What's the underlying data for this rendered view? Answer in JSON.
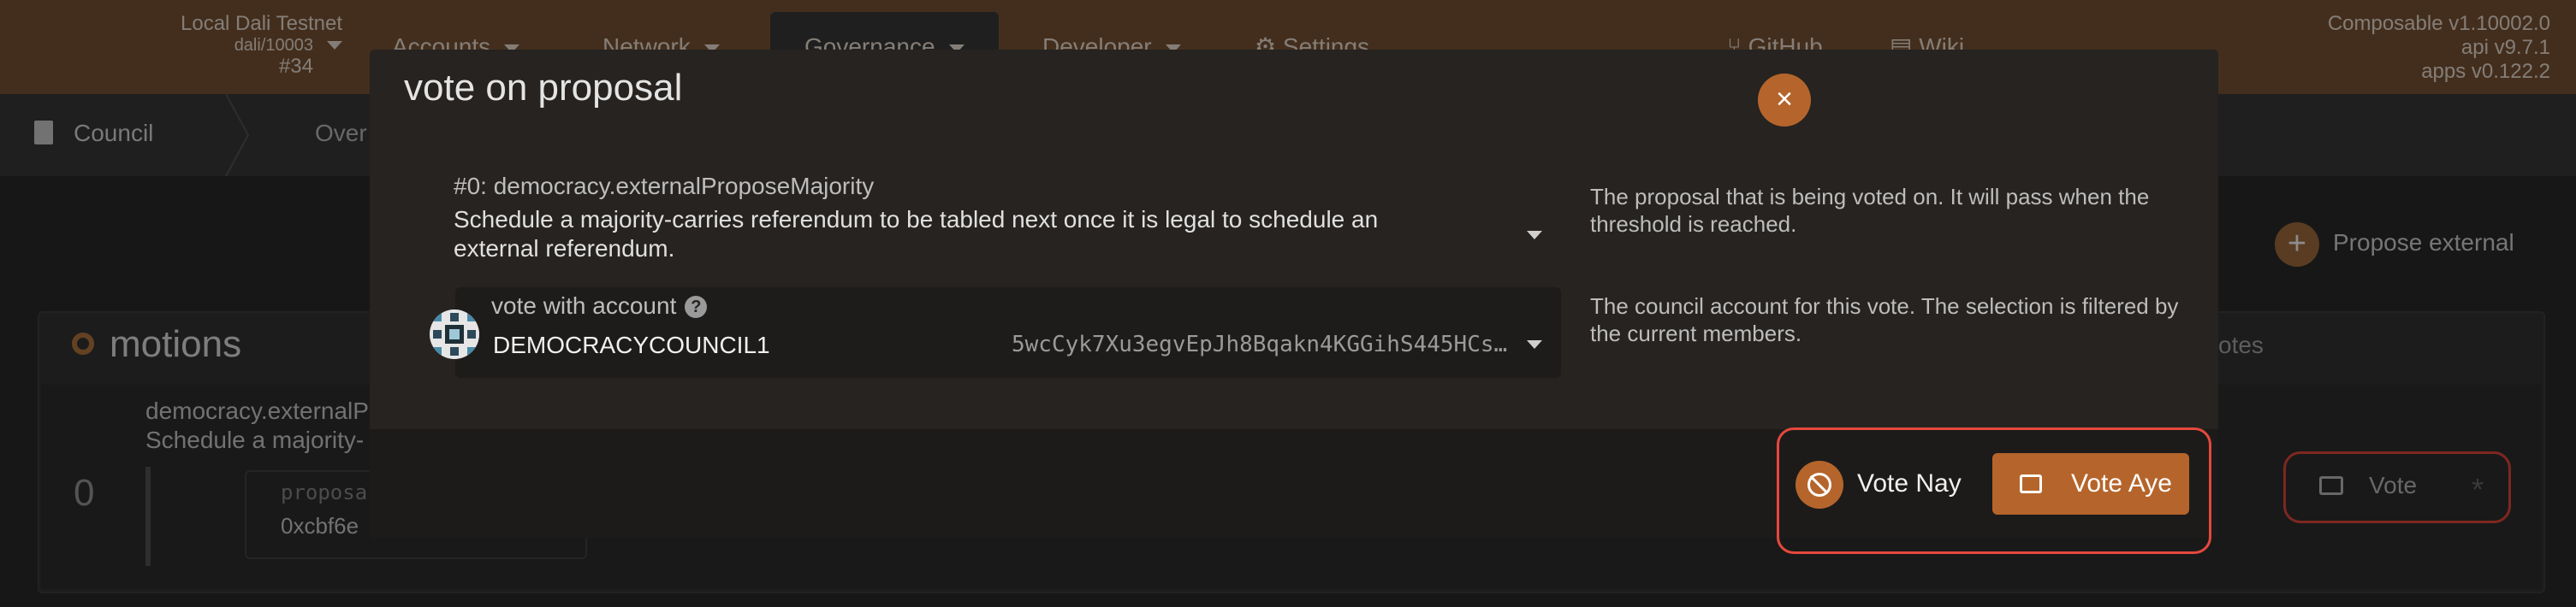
{
  "topbar": {
    "chain_name": "Local Dali Testnet",
    "chain_sub": "dali/10003",
    "chain_block": "#34",
    "nav": [
      "Accounts",
      "Network",
      "Governance",
      "Developer",
      "Settings",
      "GitHub",
      "Wiki"
    ],
    "versions": [
      "Composable v1.10002.0",
      "api v9.7.1",
      "apps v0.122.2"
    ],
    "accent": "#7a5436"
  },
  "subbar": {
    "crumb": "Council",
    "tab_partial": "Over"
  },
  "page": {
    "propose_external": "Propose external",
    "bg_partial_m": "n",
    "motions_title": "motions",
    "votes_header": "votes",
    "row_index": "0",
    "row_title_1": "democracy.externalP",
    "row_title_2": "Schedule a majority-",
    "proposal_label": "proposa",
    "proposal_value": "0xcbf6e",
    "vote_button": "Vote"
  },
  "modal": {
    "title": "vote on proposal",
    "proposal_head": "#0: democracy.externalProposeMajority",
    "proposal_desc": "Schedule a majority-carries referendum to be tabled next once it is legal to schedule an external referendum.",
    "help_proposal": "The proposal that is being voted on. It will pass when the threshold is reached.",
    "account_label": "vote with account",
    "account_name": "DEMOCRACYCOUNCIL1",
    "account_address": "5wcCyk7Xu3egvEpJh8Bqakn4KGGihS445HCsM…",
    "help_account": "The council account for this vote. The selection is filtered by the current members.",
    "vote_nay": "Vote Nay",
    "vote_aye": "Vote Aye",
    "close_symbol": "×",
    "highlight_color": "#e6483d",
    "button_color": "#b5652b"
  }
}
